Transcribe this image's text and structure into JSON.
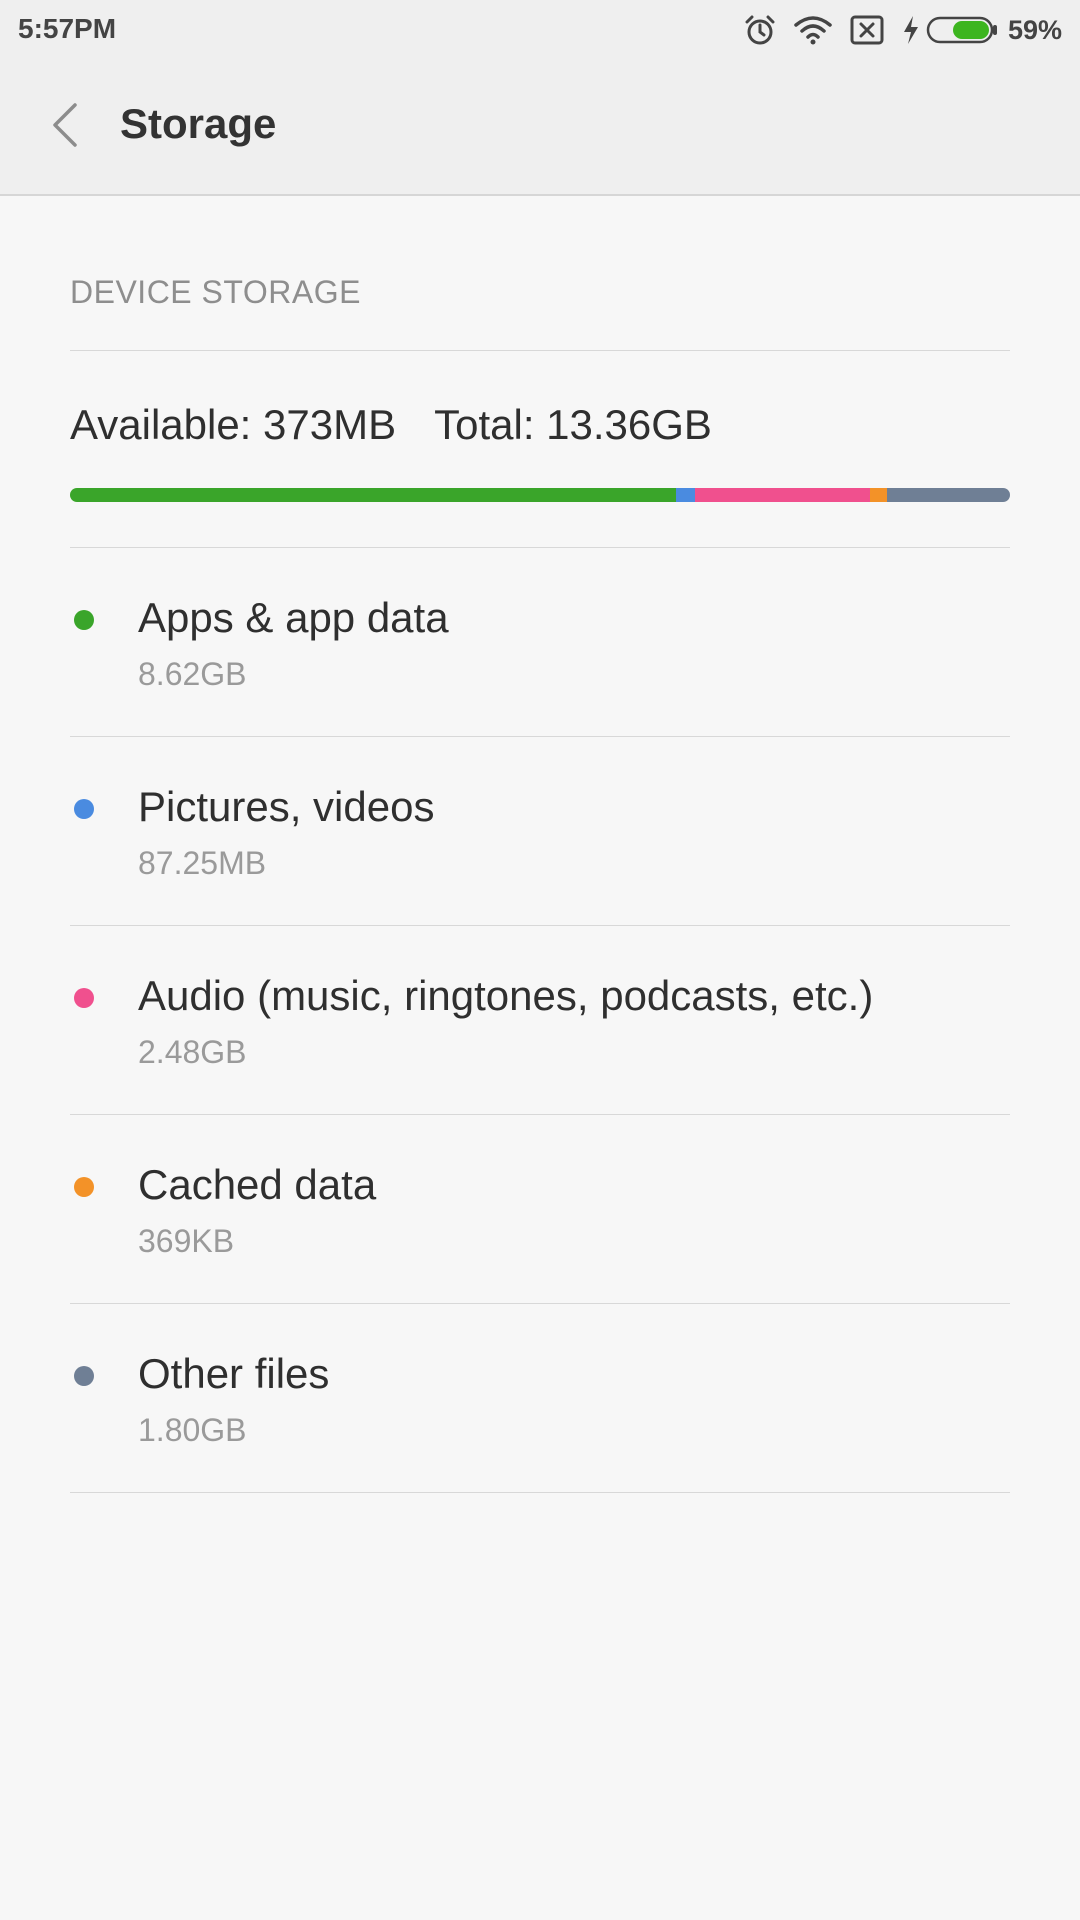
{
  "status_bar": {
    "time": "5:57PM",
    "battery_percent": "59%",
    "battery_level": 0.59,
    "icons": [
      "alarm-icon",
      "wifi-icon",
      "no-sim-icon",
      "charging-icon",
      "battery-icon"
    ]
  },
  "header": {
    "title": "Storage",
    "back_icon": "chevron-left-icon"
  },
  "device_storage": {
    "section_title": "DEVICE STORAGE",
    "available": "Available: 373MB",
    "total": "Total: 13.36GB",
    "bar_segments": [
      {
        "name": "Apps & app data",
        "fraction": 0.645,
        "color": "#3aa52a"
      },
      {
        "name": "Pictures, videos",
        "fraction": 0.02,
        "color": "#4a8be0"
      },
      {
        "name": "Audio",
        "fraction": 0.186,
        "color": "#f0508e"
      },
      {
        "name": "Cached data",
        "fraction": 0.018,
        "color": "#f39228"
      },
      {
        "name": "Other files",
        "fraction": 0.131,
        "color": "#6f7f95"
      }
    ],
    "items": [
      {
        "label": "Apps & app data",
        "size": "8.62GB",
        "color": "#3aa52a"
      },
      {
        "label": "Pictures, videos",
        "size": "87.25MB",
        "color": "#4a8be0"
      },
      {
        "label": "Audio (music, ringtones, podcasts, etc.)",
        "size": "2.48GB",
        "color": "#f0508e"
      },
      {
        "label": "Cached data",
        "size": "369KB",
        "color": "#f39228"
      },
      {
        "label": "Other files",
        "size": "1.80GB",
        "color": "#6f7f95"
      }
    ]
  }
}
